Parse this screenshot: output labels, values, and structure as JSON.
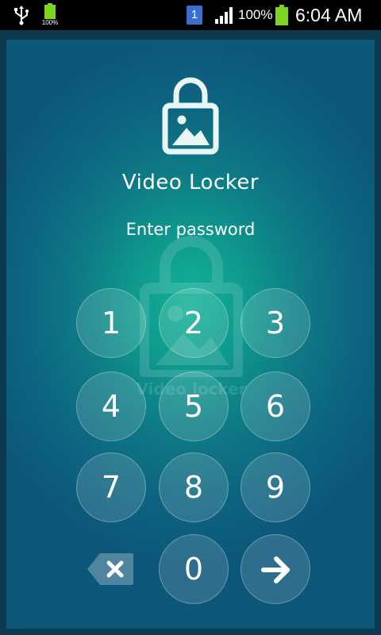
{
  "status_bar": {
    "battery_small_label": "100%",
    "notification_badge": "1",
    "battery_percent": "100%",
    "time": "6:04 AM",
    "icons": [
      "usb-icon",
      "battery-charging-icon",
      "notification-icon",
      "signal-icon",
      "battery-icon"
    ]
  },
  "app": {
    "title": "Video Locker",
    "prompt": "Enter password",
    "watermark_text": "Video locker",
    "icon": "lock-image-icon"
  },
  "keypad": {
    "keys": [
      "1",
      "2",
      "3",
      "4",
      "5",
      "6",
      "7",
      "8",
      "9",
      "0"
    ],
    "delete_icon": "backspace-icon",
    "enter_icon": "arrow-right-icon"
  },
  "colors": {
    "gradient_center": "#12b296",
    "gradient_edge": "#0c577a",
    "text": "#ffffff",
    "status_bar": "#000000"
  }
}
